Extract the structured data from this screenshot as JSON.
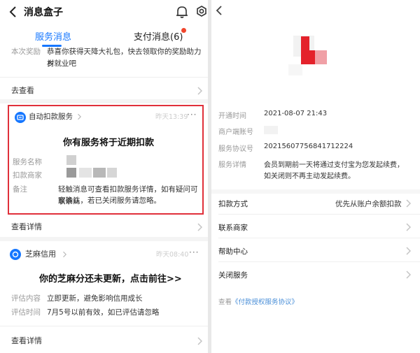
{
  "left": {
    "title": "消息盒子",
    "tabs": [
      {
        "label": "服务消息"
      },
      {
        "label": "支付消息(6)"
      }
    ],
    "reward": {
      "label": "本次奖励",
      "text_line1": "恭喜你获得天降大礼包，快去领取你的奖励助力乡",
      "text_line2": "村就业吧"
    },
    "go_view": "去查看",
    "auto_deduct": {
      "service_name": "自动扣款服务",
      "time": "昨天13:39",
      "heading": "你有服务将于近期扣款",
      "fields": [
        {
          "label": "服务名称"
        },
        {
          "label": "扣款商家"
        },
        {
          "label": "备注",
          "value_line1": "轻触消息可查看扣款服务详情，如有疑问可联系商",
          "value_line2": "家确认，若已关闭服务请忽略。"
        }
      ]
    },
    "view_details_1": "查看详情",
    "sesame": {
      "name": "芝麻信用",
      "time": "昨天08:40",
      "heading": "你的芝麻分还未更新，点击前往>>",
      "fields": [
        {
          "label": "评估内容",
          "value": "立即更新，避免影响信用成长"
        },
        {
          "label": "评估时间",
          "value": "7月5号以前有效，如已评估请忽略"
        }
      ]
    },
    "view_details_2": "查看详情",
    "colors": {
      "accent": "#1677ff",
      "highlight_border": "#e0303a",
      "badge": "#f0452c"
    }
  },
  "right": {
    "info": [
      {
        "label": "开通时间",
        "value": "2021-08-07 21:43"
      },
      {
        "label": "商户端账号",
        "value": ""
      },
      {
        "label": "服务协议号",
        "value": "20215607756841712224"
      },
      {
        "label": "服务详情",
        "value_line1": "会员到期前一天将通过支付宝为您发起续费，",
        "value_line2": "如关闭则不再主动发起续费。"
      }
    ],
    "menu": [
      {
        "label": "扣款方式",
        "value": "优先从账户余额扣款"
      },
      {
        "label": "联系商家",
        "value": ""
      },
      {
        "label": "帮助中心",
        "value": ""
      },
      {
        "label": "关闭服务",
        "value": ""
      }
    ],
    "agreement": {
      "prefix": "查看",
      "link": "《付款授权服务协议》"
    }
  }
}
